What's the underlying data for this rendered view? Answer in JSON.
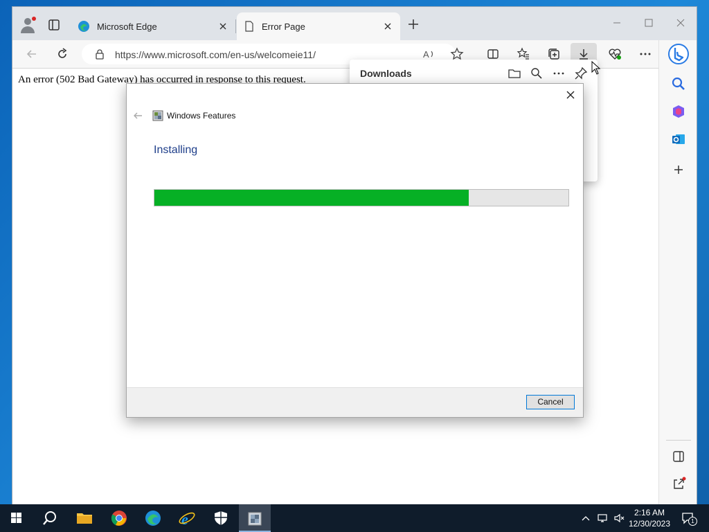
{
  "browser": {
    "tabs": [
      {
        "label": "Microsoft Edge",
        "icon": "edge-icon"
      },
      {
        "label": "Error Page",
        "icon": "page-icon"
      }
    ],
    "url": "https://www.microsoft.com/en-us/welcomeie11/",
    "page_text": "An error (502 Bad Gateway) has occurred in response to this request."
  },
  "downloads": {
    "title": "Downloads"
  },
  "dialog": {
    "app_title": "Windows Features",
    "heading": "Installing",
    "progress": 0.76,
    "cancel_label": "Cancel"
  },
  "taskbar": {
    "time": "2:16 AM",
    "date": "12/30/2023",
    "notification_count": "1",
    "apps": [
      "start-icon",
      "search-icon",
      "file-explorer-icon",
      "chrome-icon",
      "edge-icon",
      "internet-explorer-icon",
      "windows-security-icon",
      "windows-features-icon"
    ]
  },
  "colors": {
    "progress_green": "#06b025",
    "heading_blue": "#1e3e8a",
    "accent": "#0078d7"
  }
}
